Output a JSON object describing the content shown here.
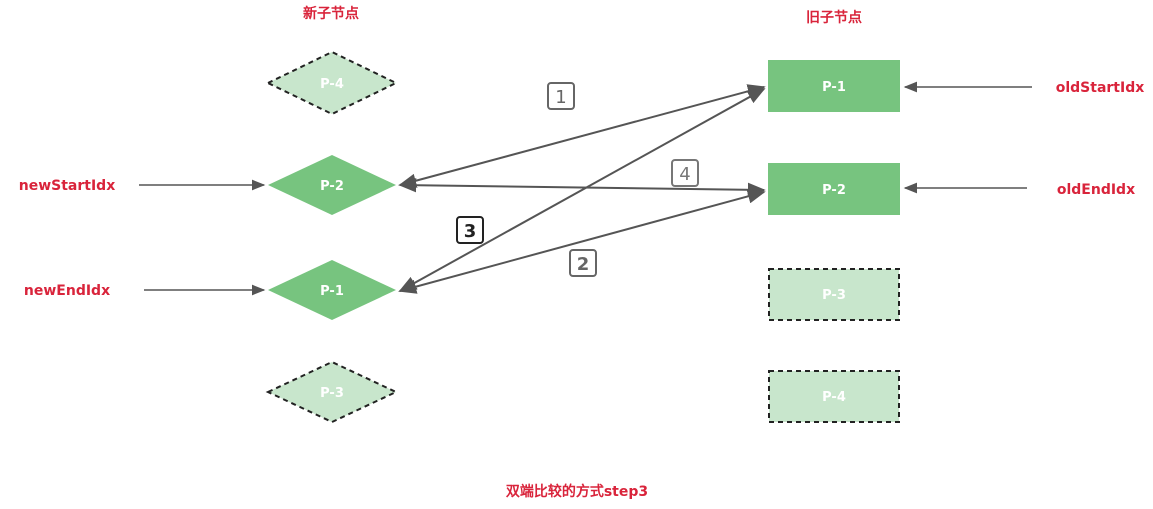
{
  "headers": {
    "new": "新子节点",
    "old": "旧子节点"
  },
  "pointers": {
    "newStart": "newStartIdx",
    "newEnd": "newEndIdx",
    "oldStart": "oldStartIdx",
    "oldEnd": "oldEndIdx"
  },
  "new_nodes": [
    {
      "label": "P-4",
      "status": "dashed"
    },
    {
      "label": "P-2",
      "status": "solid"
    },
    {
      "label": "P-1",
      "status": "solid"
    },
    {
      "label": "P-3",
      "status": "dashed"
    }
  ],
  "old_nodes": [
    {
      "label": "P-1",
      "status": "solid"
    },
    {
      "label": "P-2",
      "status": "solid"
    },
    {
      "label": "P-3",
      "status": "dashed"
    },
    {
      "label": "P-4",
      "status": "dashed"
    }
  ],
  "steps": {
    "s1": "1",
    "s2": "2",
    "s3": "3",
    "s4": "4"
  },
  "caption": "双端比较的方式step3",
  "colors": {
    "solid": "#77c47f",
    "faded": "#c8e6cc",
    "pointer_text": "#d9243b",
    "arrow": "#555555"
  }
}
